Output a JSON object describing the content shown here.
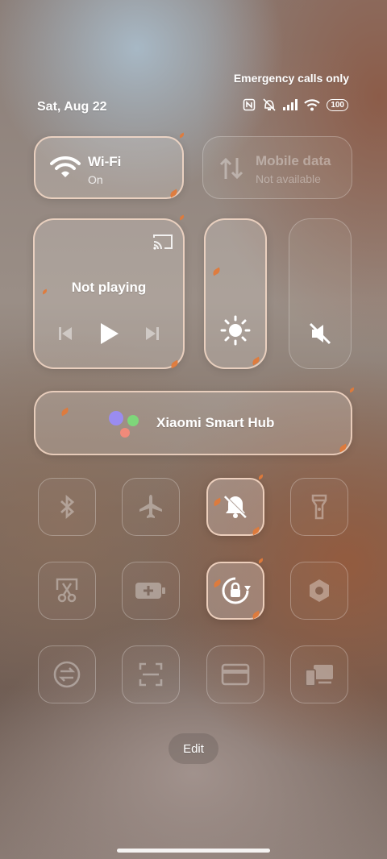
{
  "status_bar": {
    "carrier_text": "Emergency calls only",
    "date": "Sat, Aug 22",
    "battery_level": "100",
    "icons": [
      "nfc-icon",
      "vibrate-off-icon",
      "signal-icon",
      "wifi-icon",
      "battery-icon"
    ]
  },
  "wifi": {
    "title": "Wi-Fi",
    "status": "On"
  },
  "mobile_data": {
    "title": "Mobile data",
    "status": "Not available"
  },
  "media": {
    "status": "Not playing"
  },
  "smart_hub": {
    "label": "Xiaomi Smart Hub"
  },
  "toggles": [
    {
      "name": "bluetooth",
      "icon": "bluetooth-icon",
      "active": false
    },
    {
      "name": "airplane-mode",
      "icon": "airplane-icon",
      "active": false
    },
    {
      "name": "silent",
      "icon": "bell-off-icon",
      "active": true
    },
    {
      "name": "flashlight",
      "icon": "flashlight-icon",
      "active": false
    },
    {
      "name": "screenshot",
      "icon": "scissors-icon",
      "active": false
    },
    {
      "name": "battery-saver",
      "icon": "battery-plus-icon",
      "active": false
    },
    {
      "name": "lock-rotation",
      "icon": "rotation-lock-icon",
      "active": true
    },
    {
      "name": "settings",
      "icon": "gear-icon",
      "active": false
    },
    {
      "name": "sync",
      "icon": "sync-icon",
      "active": false
    },
    {
      "name": "scanner",
      "icon": "scan-icon",
      "active": false
    },
    {
      "name": "card",
      "icon": "card-icon",
      "active": false
    },
    {
      "name": "cast-screen",
      "icon": "devices-icon",
      "active": false
    }
  ],
  "edit_label": "Edit",
  "colors": {
    "accent_border": "#ffe1cd",
    "leaf": "#e07a3a"
  }
}
